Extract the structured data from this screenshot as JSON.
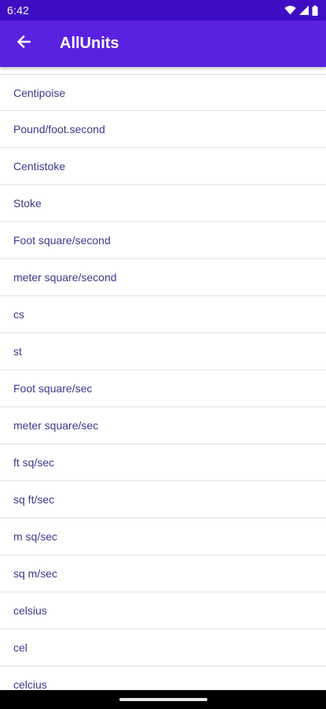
{
  "status_bar": {
    "time": "6:42",
    "icons": [
      "wifi-icon",
      "cell-signal-icon",
      "battery-icon"
    ]
  },
  "app_bar": {
    "title": "AllUnits",
    "back_icon": "arrow-back-icon"
  },
  "units": [
    "Centipoise",
    "Pound/foot.second",
    "Centistoke",
    "Stoke",
    "Foot square/second",
    "meter square/second",
    "cs",
    "st",
    "Foot square/sec",
    "meter square/sec",
    "ft sq/sec",
    "sq ft/sec",
    "m sq/sec",
    "sq m/sec",
    "celsius",
    "cel",
    "celcius"
  ],
  "colors": {
    "status_bar": "#3d0ec4",
    "app_bar": "#5b21e0",
    "item_text": "#3a3a8c",
    "divider": "#e2e2e2"
  }
}
